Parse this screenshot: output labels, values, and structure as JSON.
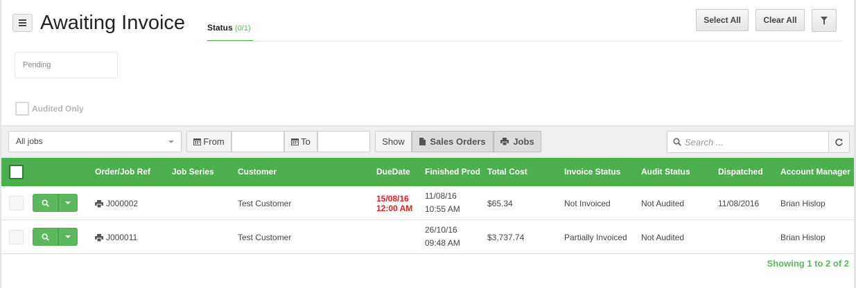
{
  "header": {
    "title": "Awaiting Invoice",
    "status_tab": {
      "label": "Status",
      "count": "(0/1)"
    },
    "select_all": "Select All",
    "clear_all": "Clear All"
  },
  "filters": {
    "pending": "Pending",
    "audited_only": "Audited Only"
  },
  "toolbar": {
    "jobs_select": "All jobs",
    "from_label": "From",
    "to_label": "To",
    "show_label": "Show",
    "sales_orders_label": "Sales Orders",
    "jobs_label": "Jobs",
    "search_placeholder": "Search ..."
  },
  "table": {
    "columns": [
      "Order/Job Ref",
      "Job Series",
      "Customer",
      "DueDate",
      "Finished Prod",
      "Total Cost",
      "Invoice Status",
      "Audit Status",
      "Dispatched",
      "Account Manager"
    ],
    "rows": [
      {
        "ref": "J000002",
        "job_series": "",
        "customer": "Test Customer",
        "due_date": "15/08/16",
        "due_time": "12:00 AM",
        "finished_date": "11/08/16",
        "finished_time": "10:55 AM",
        "total_cost": "$65.34",
        "invoice_status": "Not Invoiced",
        "audit_status": "Not Audited",
        "dispatched": "11/08/2016",
        "account_manager": "Brian Hislop"
      },
      {
        "ref": "J000011",
        "job_series": "",
        "customer": "Test Customer",
        "due_date": "",
        "due_time": "",
        "finished_date": "26/10/16",
        "finished_time": "09:48 AM",
        "total_cost": "$3,737.74",
        "invoice_status": "Partially Invoiced",
        "audit_status": "Not Audited",
        "dispatched": "",
        "account_manager": "Brian Hislop"
      }
    ]
  },
  "pager": {
    "text": "Showing 1 to 2 of 2"
  },
  "colors": {
    "accent": "#4cae4c",
    "due_red": "#e01f1f"
  }
}
